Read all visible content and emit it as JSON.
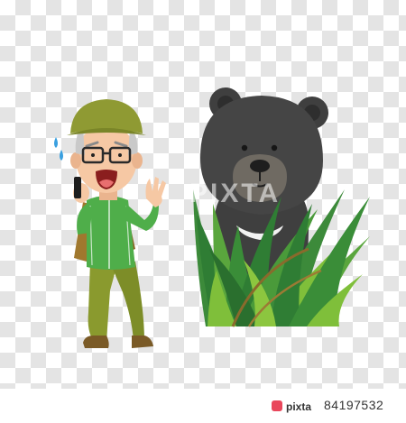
{
  "watermark": {
    "text": "PIXTA"
  },
  "footer": {
    "logo_text": "pixta",
    "image_id": "84197532"
  },
  "colors": {
    "jacket": "#4fae4a",
    "pants": "#8a9a2e",
    "hat": "#8f9a33",
    "bear": "#3f3f3f",
    "bear_muzzle": "#6f6a62",
    "grass_dark": "#2f7d34",
    "grass_light": "#7fbf3a",
    "skin": "#f6c8a4"
  },
  "icons": {
    "sweat": "sweat-drops-icon",
    "phone": "phone-icon"
  }
}
